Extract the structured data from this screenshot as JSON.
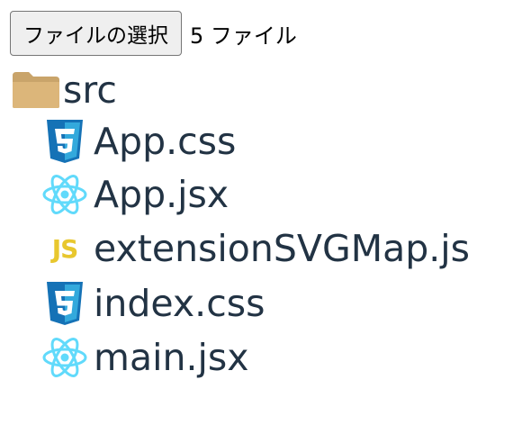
{
  "file_input": {
    "button_label": "ファイルの選択",
    "status_text": "5 ファイル"
  },
  "tree": {
    "folder": {
      "name": "src",
      "icon": "folder-icon"
    },
    "files": [
      {
        "name": "App.css",
        "icon": "css3-icon"
      },
      {
        "name": "App.jsx",
        "icon": "react-icon"
      },
      {
        "name": "extensionSVGMap.js",
        "icon": "javascript-icon",
        "glyph": "JS"
      },
      {
        "name": "index.css",
        "icon": "css3-icon"
      },
      {
        "name": "main.jsx",
        "icon": "react-icon"
      }
    ]
  },
  "colors": {
    "text": "#223344",
    "folder": "#dcb67a",
    "css": "#1572b6",
    "react": "#61dafb",
    "js": "#e8c72e"
  }
}
